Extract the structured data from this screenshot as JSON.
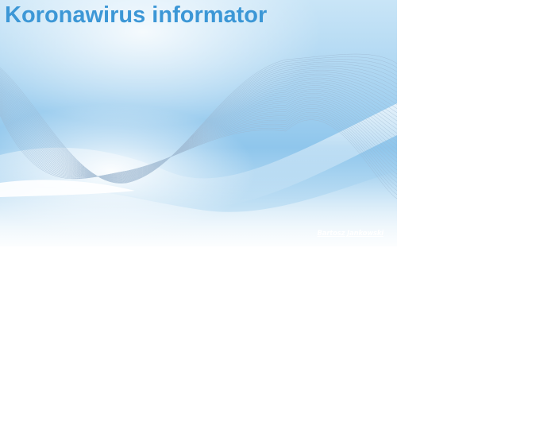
{
  "banner": {
    "title": "Koronawirus informator",
    "author_link": "Bartosz Jankowski"
  },
  "colors": {
    "title": "#3c97d6",
    "background_light": "#c9e5f7",
    "background_mid": "#8fc6ec",
    "wave_lines": "#9cb6cf"
  }
}
